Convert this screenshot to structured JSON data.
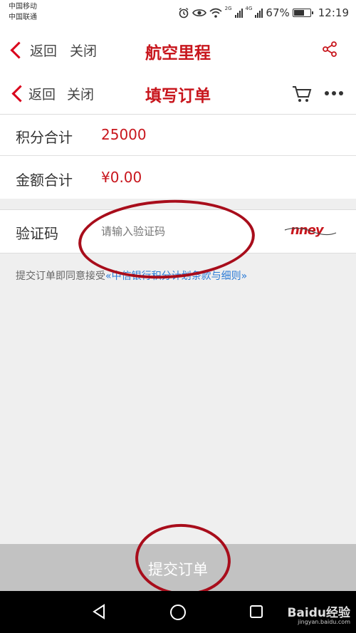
{
  "status_bar": {
    "carrier1": "中国移动",
    "carrier2": "中国联通",
    "net1": "2G",
    "net2": "4G",
    "battery_pct": "67%",
    "battery_level": 0.67,
    "time": "12:19",
    "icons": [
      "alarm-icon",
      "eye-icon",
      "wifi-icon",
      "signal-icon",
      "battery-icon"
    ]
  },
  "nav1": {
    "back": "返回",
    "close": "关闭",
    "title": "航空里程",
    "right_icon": "share-icon"
  },
  "nav2": {
    "back": "返回",
    "close": "关闭",
    "title": "填写订单",
    "right_icons": [
      "cart-icon",
      "more-icon"
    ]
  },
  "form": {
    "points_label": "积分合计",
    "points_value": "25000",
    "amount_label": "金额合计",
    "amount_value": "¥0.00",
    "captcha_label": "验证码",
    "captcha_placeholder": "请输入验证码",
    "captcha_image_text": "nney"
  },
  "agreement": {
    "prefix": "提交订单即同意接受",
    "link": "«中信银行积分计划条款与细则»"
  },
  "submit": {
    "label": "提交订单"
  },
  "system_nav": {
    "icons": [
      "back-triangle-icon",
      "home-circle-icon",
      "recents-square-icon"
    ]
  },
  "watermark": {
    "brand": "Baidu经验",
    "url": "jingyan.baidu.com"
  },
  "colors": {
    "brand_red": "#c8161d",
    "link_blue": "#2a7ad6",
    "annotation_red": "#a80d1b",
    "submit_bg": "#c2c2c2"
  }
}
